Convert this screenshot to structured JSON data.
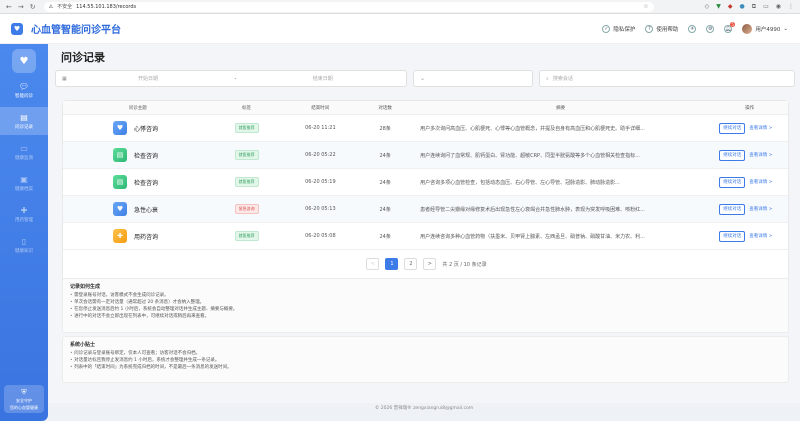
{
  "browser": {
    "insecure_label": "不安全",
    "url": "114.55.101.183/records"
  },
  "header": {
    "app_title": "心血管智能问诊平台",
    "privacy": "隐私保护",
    "help": "使用帮助",
    "notification_count": "5",
    "username": "用户4990"
  },
  "sidebar": {
    "items": [
      {
        "label": "智能问诊",
        "icon": "chat-icon"
      },
      {
        "label": "问诊记录",
        "icon": "records-icon"
      },
      {
        "label": "健康监测",
        "icon": "monitor-icon"
      },
      {
        "label": "健康档案",
        "icon": "profile-icon"
      },
      {
        "label": "用药管理",
        "icon": "medication-icon"
      },
      {
        "label": "健康知识",
        "icon": "knowledge-icon"
      }
    ],
    "footer_line1": "安全守护",
    "footer_line2": "您的心血管健康"
  },
  "page": {
    "title": "问诊记录"
  },
  "filters": {
    "start_placeholder": "开始日期",
    "separator": "-",
    "end_placeholder": "结束日期",
    "search_placeholder": "搜索会话"
  },
  "table": {
    "headers": [
      "问诊主题",
      "标签",
      "结束时间",
      "对话数",
      "摘要",
      "操作"
    ],
    "rows": [
      {
        "title": "心悸咨询",
        "icon_color": "blue",
        "tag": "就医推荐",
        "tag_color": "green",
        "time": "06-20 11:21",
        "count": "28条",
        "summary": "用户多次询问高血压、心肌梗死、心悸等心血管概念，并提及自身有高血压和心肌梗死史。助手详细..."
      },
      {
        "title": "检查咨询",
        "icon_color": "green",
        "tag": "就医推荐",
        "tag_color": "green",
        "time": "06-20 05:22",
        "count": "24条",
        "summary": "用户连续询问了血常规、肌钙蛋白、肾功能、超敏CRP、同型半胱氨酸等多个心血管相关检查指标..."
      },
      {
        "title": "检查咨询",
        "icon_color": "green",
        "tag": "就医推荐",
        "tag_color": "green",
        "time": "06-20 05:19",
        "count": "24条",
        "summary": "用户咨询多项心血管检查，包括动态血压、右心导管、左心导管、冠脉造影、肺动脉造影..."
      },
      {
        "title": "急性心衰",
        "icon_color": "blue",
        "tag": "紧急咨询",
        "tag_color": "red",
        "time": "06-20 05:13",
        "count": "24条",
        "summary": "患者经导管二尖瓣缘对缘修复术后出现急性左心衰竭合并急性肺水肿，表现为突发呼吸困难、咳粉红..."
      },
      {
        "title": "用药咨询",
        "icon_color": "orange",
        "tag": "就医推荐",
        "tag_color": "green",
        "time": "06-20 05:08",
        "count": "24条",
        "summary": "用户连续咨询多种心血管药物（扶墨米、贝甲肾上腺素、左西孟旦、硝普钠、硝酸甘油、米力农、利..."
      }
    ],
    "continue_label": "继续对话",
    "detail_label": "查看详情 >"
  },
  "pagination": {
    "prev": "<",
    "pages": [
      "1",
      "2"
    ],
    "next": ">",
    "summary": "共 2 页 / 10 条记录"
  },
  "info_generation": {
    "title": "记录如何生成",
    "items": [
      "需登录账号对话，访客模式不会生成问诊记录。",
      "单次会话需有一定对话量（通常超过 20 条消息）才会纳入整理。",
      "在您停止发送消息后约 1 小时后，系统会自动整理对话并生成主题、摘要与概要。",
      "进行中的对话不会立即出现在列表中，可继续对话或稍后再来查看。"
    ]
  },
  "info_tips": {
    "title": "系统小贴士",
    "items": [
      "问诊记录与登录账号绑定，仅本人可查看；访客对话不会归档。",
      "对话量达标且我停止发消息约 1 小时后，系统才会整理并生成一条记录。",
      "列表中的「结束时间」为系统完成归档的时间，不是最后一条消息的发送时间。"
    ]
  },
  "footer": {
    "text": "© 2026 曾祥瑞® zengxiangrui8@gmail.com"
  }
}
